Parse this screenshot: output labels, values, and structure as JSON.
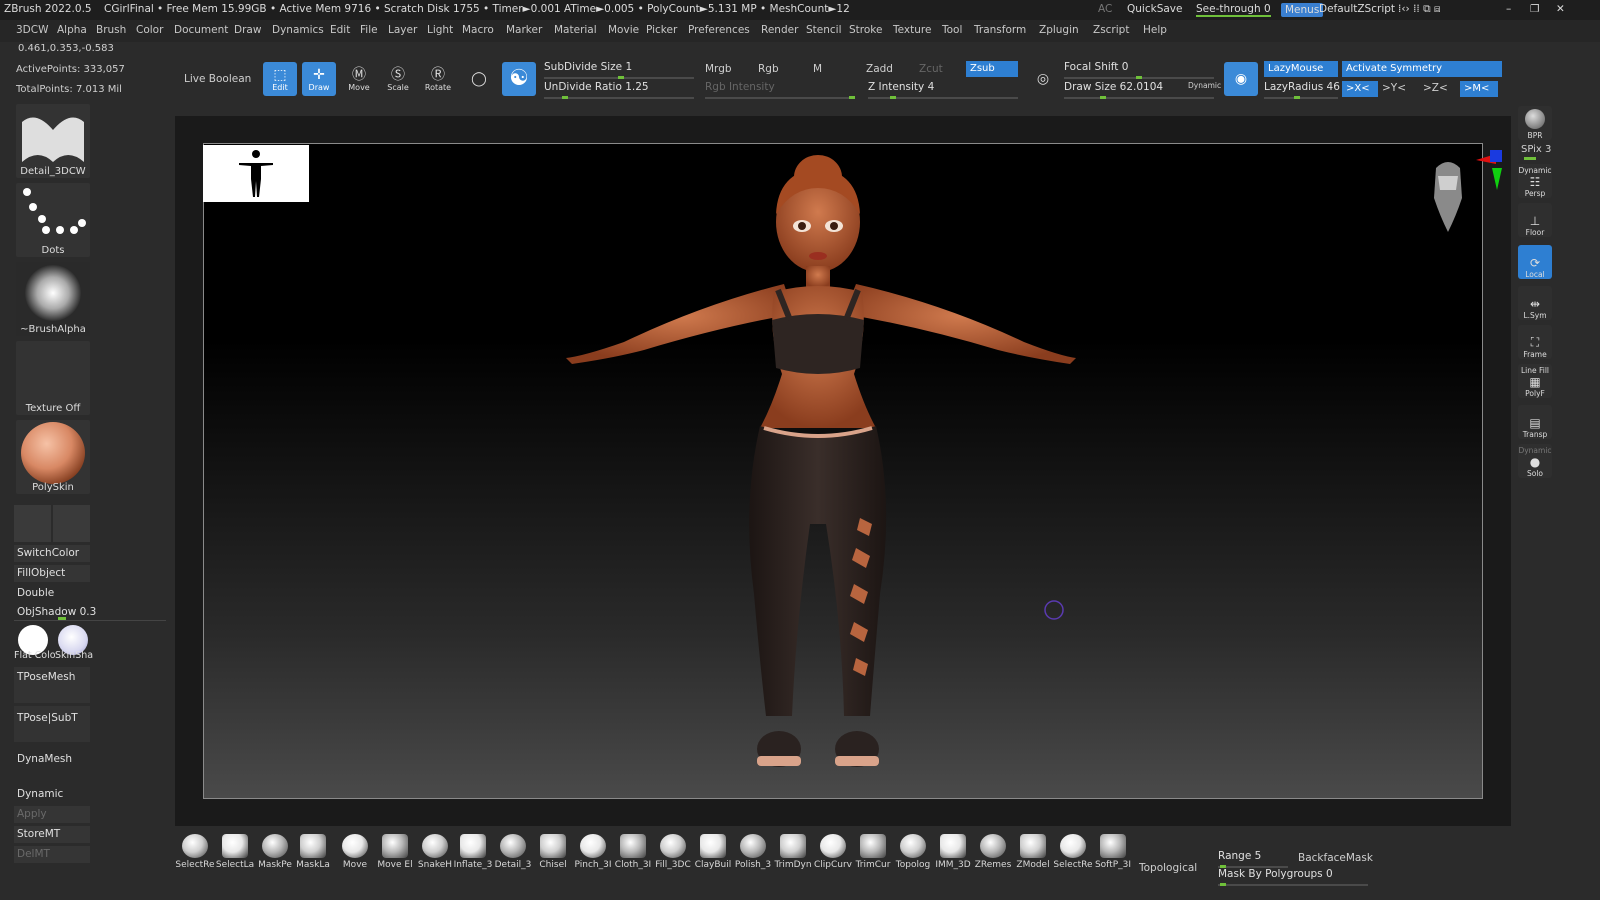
{
  "titlebar": {
    "app": "ZBrush 2022.0.5",
    "project": "CGirlFinal",
    "stats": "• Free Mem 15.99GB • Active Mem 9716 • Scratch Disk 1755 • Timer►0.001 ATime►0.005 • PolyCount►5.131 MP • MeshCount►12",
    "ac": "AC",
    "quicksave": "QuickSave",
    "seethrough": "See-through   0",
    "menus": "Menus",
    "zscript": "DefaultZScript"
  },
  "menubar": [
    "3DCW",
    "Alpha",
    "Brush",
    "Color",
    "Document",
    "Draw",
    "Dynamics",
    "Edit",
    "File",
    "Layer",
    "Light",
    "Macro",
    "Marker",
    "Material",
    "Movie",
    "Picker",
    "Preferences",
    "Render",
    "Stencil",
    "Stroke",
    "Texture",
    "Tool",
    "Transform",
    "Zplugin",
    "Zscript",
    "Help"
  ],
  "info": {
    "coords": "0.461,0.353,-0.583",
    "active_points": "ActivePoints: 333,057",
    "total_points": "TotalPoints: 7.013 Mil"
  },
  "toolbar": {
    "live_boolean": "Live Boolean",
    "edit": "Edit",
    "draw": "Draw",
    "move": "Move",
    "scale": "Scale",
    "rotate": "Rotate",
    "subdivide_size": "SubDivide Size 1",
    "undivide_ratio": "UnDivide Ratio 1.25",
    "mrgb": "Mrgb",
    "rgb": "Rgb",
    "m": "M",
    "rgb_intensity": "Rgb Intensity",
    "zadd": "Zadd",
    "zcut": "Zcut",
    "zsub": "Zsub",
    "z_intensity": "Z Intensity 4",
    "focal_shift": "Focal Shift 0",
    "draw_size": "Draw Size 62.0104",
    "dynamic": "Dynamic",
    "lazymouse": "LazyMouse",
    "lazyradius": "LazyRadius 46",
    "activate_symmetry": "Activate Symmetry",
    "sym_x": ">X<",
    "sym_y": ">Y<",
    "sym_z": ">Z<",
    "sym_m": ">M<"
  },
  "left_panel": {
    "brush": "Detail_3DCW",
    "stroke": "Dots",
    "alpha": "~BrushAlpha",
    "texture": "Texture Off",
    "material": "PolySkin",
    "switchcolor": "SwitchColor",
    "fillobject": "FillObject",
    "double": "Double",
    "objshadow": "ObjShadow 0.3",
    "flat_color": "Flat Colo",
    "skin_shade": "SkinSha",
    "tposemesh": "TPoseMesh",
    "tpose_subt": "TPose|SubT",
    "dynamesh": "DynaMesh",
    "dynamic": "Dynamic",
    "apply": "Apply",
    "storemt": "StoreMT",
    "delmt": "DelMT"
  },
  "right_panel": {
    "bpr": "BPR",
    "spix": "SPix 3",
    "persp": "Persp",
    "dynamic_label": "Dynamic",
    "floor": "Floor",
    "local": "Local",
    "lsym": "L.Sym",
    "frame": "Frame",
    "line_fill": "Line Fill",
    "polyf": "PolyF",
    "transp": "Transp",
    "dynamic2": "Dynamic",
    "solo": "Solo"
  },
  "shelf": {
    "items": [
      "SelectRe",
      "SelectLa",
      "MaskPe",
      "MaskLa",
      "Move",
      "Move El",
      "SnakeH",
      "Inflate_3",
      "Detail_3",
      "Chisel",
      "Pinch_3I",
      "Cloth_3I",
      "Fill_3DC",
      "ClayBuil",
      "Polish_3",
      "TrimDyn",
      "ClipCurv",
      "TrimCur",
      "Topolog",
      "IMM_3D",
      "ZRemes",
      "ZModel",
      "SelectRe",
      "SoftP_3I"
    ],
    "topological": "Topological",
    "range": "Range 5",
    "backfacemask": "BackfaceMask",
    "mask_by_polygroups": "Mask By Polygroups 0"
  },
  "colors": {
    "accent_blue": "#2e7fd2",
    "slider_green": "#6fc03a",
    "skin": "#b8653f",
    "hair": "#a44a22",
    "outfit": "#2e2522"
  }
}
